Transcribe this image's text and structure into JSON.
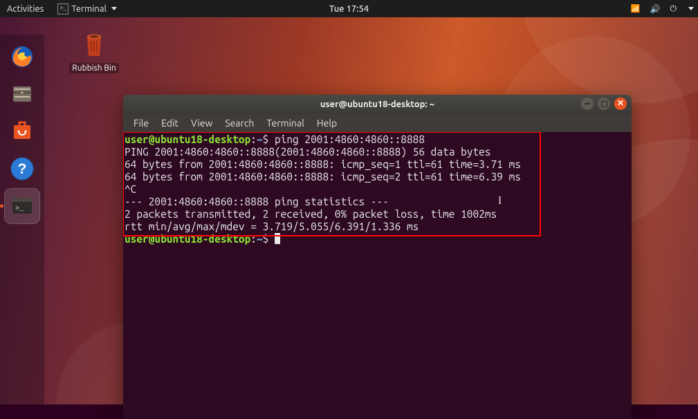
{
  "top_panel": {
    "activities": "Activities",
    "app_menu": "Terminal",
    "clock": "Tue 17:54"
  },
  "dock_items": [
    "firefox",
    "files",
    "software-center",
    "help",
    "terminal"
  ],
  "desktop_icon": {
    "label": "Rubbish Bin"
  },
  "window": {
    "title": "user@ubuntu18-desktop: ~",
    "menus": [
      "File",
      "Edit",
      "View",
      "Search",
      "Terminal",
      "Help"
    ]
  },
  "terminal": {
    "prompt_user": "user@ubuntu18-desktop",
    "prompt_path": "~",
    "prompt_symbol": "$",
    "entries": [
      {
        "kind": "prompt",
        "command": "ping 2001:4860:4860::8888"
      },
      {
        "kind": "output",
        "text": "PING 2001:4860:4860::8888(2001:4860:4860::8888) 56 data bytes"
      },
      {
        "kind": "output",
        "text": "64 bytes from 2001:4860:4860::8888: icmp_seq=1 ttl=61 time=3.71 ms"
      },
      {
        "kind": "output",
        "text": "64 bytes from 2001:4860:4860::8888: icmp_seq=2 ttl=61 time=6.39 ms"
      },
      {
        "kind": "output",
        "text": "^C"
      },
      {
        "kind": "output",
        "text": "--- 2001:4860:4860::8888 ping statistics ---"
      },
      {
        "kind": "output",
        "text": "2 packets transmitted, 2 received, 0% packet loss, time 1002ms"
      },
      {
        "kind": "output",
        "text": "rtt min/avg/max/mdev = 3.719/5.055/6.391/1.336 ms"
      },
      {
        "kind": "prompt",
        "command": ""
      }
    ]
  },
  "status_icons": [
    "network-wireless",
    "volume-high",
    "power"
  ]
}
